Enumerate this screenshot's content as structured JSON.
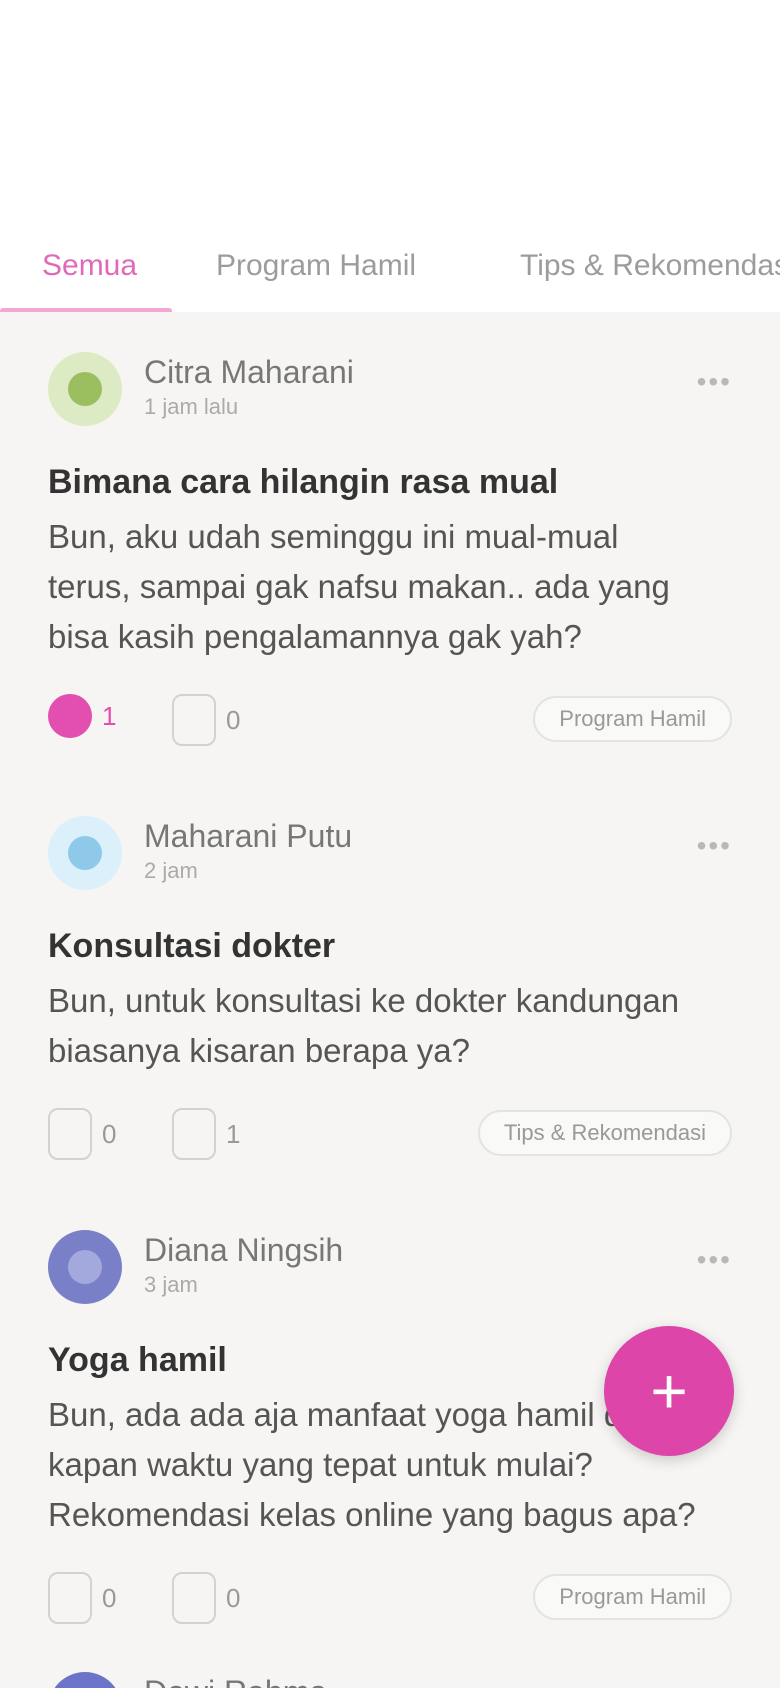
{
  "tabs": [
    {
      "label": "Semua"
    },
    {
      "label": "Program Hamil"
    },
    {
      "label": "Tips & Rekomendasi"
    }
  ],
  "colors": {
    "accent": "#e24fb0",
    "tab_active": "#e06ab8",
    "fab": "#dd45a9",
    "background": "#f6f5f3"
  },
  "posts": [
    {
      "author": "Citra Maharani",
      "meta": "1 jam lalu",
      "avatar_color": "#9bbf5e",
      "title": "Bimana cara hilangin rasa mual",
      "body": "Bun, aku udah seminggu ini mual-mual terus, sampai gak nafsu makan.. ada yang bisa kasih pengalamannya gak yah?",
      "likes": "1",
      "comments": "0",
      "category": "Program Hamil",
      "liked": true
    },
    {
      "author": "Maharani Putu",
      "meta": "2 jam",
      "avatar_color": "#8ec9ea",
      "title": "Konsultasi dokter",
      "body": "Bun, untuk konsultasi ke dokter kandungan biasanya kisaran berapa ya?",
      "likes": "0",
      "comments": "1",
      "category": "Tips & Rekomendasi",
      "liked": false
    },
    {
      "author": "Diana Ningsih",
      "meta": "3 jam",
      "avatar_color": "#7a80c8",
      "title": "Yoga hamil",
      "body": "Bun, ada ada aja manfaat yoga hamil dan kapan waktu yang tepat untuk mulai? Rekomendasi kelas online yang bagus apa?",
      "likes": "0",
      "comments": "0",
      "category": "Program Hamil",
      "liked": false
    }
  ],
  "more_label": "•••",
  "fab": {
    "label": "+"
  },
  "next_post": {
    "author": "Dewi Rahma"
  }
}
